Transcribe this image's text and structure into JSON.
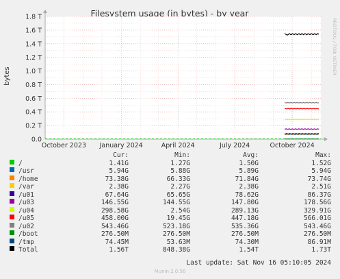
{
  "chart_data": {
    "type": "line",
    "title": "Filesystem usage (in bytes) - by year",
    "ylabel": "bytes",
    "side_label": "RRDTOOL / TOBI OETIKER",
    "ylim": [
      0,
      1.8
    ],
    "yunit": "T",
    "y_ticks": [
      {
        "value": 0.0,
        "label": "0.0"
      },
      {
        "value": 0.2,
        "label": "0.2 T"
      },
      {
        "value": 0.4,
        "label": "0.4 T"
      },
      {
        "value": 0.6,
        "label": "0.6 T"
      },
      {
        "value": 0.8,
        "label": "0.8 T"
      },
      {
        "value": 1.0,
        "label": "1.0 T"
      },
      {
        "value": 1.2,
        "label": "1.2 T"
      },
      {
        "value": 1.4,
        "label": "1.4 T"
      },
      {
        "value": 1.6,
        "label": "1.6 T"
      },
      {
        "value": 1.8,
        "label": "1.8 T"
      }
    ],
    "x_range": [
      "2023-09-01",
      "2024-11-16"
    ],
    "x_ticks": [
      {
        "date": "2023-10-01",
        "label": "October 2023"
      },
      {
        "date": "2024-01-01",
        "label": "January 2024"
      },
      {
        "date": "2024-04-01",
        "label": "April 2024"
      },
      {
        "date": "2024-07-01",
        "label": "July 2024"
      },
      {
        "date": "2024-10-01",
        "label": "October 2024"
      }
    ],
    "data_start": "2024-09-19",
    "series": [
      {
        "name": "/",
        "color": "#00cc00",
        "level": 0.0015
      },
      {
        "name": "/usr",
        "color": "#0066b3",
        "level": 0.006
      },
      {
        "name": "/home",
        "color": "#ff8000",
        "level": 0.072
      },
      {
        "name": "/var",
        "color": "#ffcc00",
        "level": 0.0024
      },
      {
        "name": "/u01",
        "color": "#330099",
        "level": 0.079
      },
      {
        "name": "/u03",
        "color": "#990099",
        "level": 0.148
      },
      {
        "name": "/u04",
        "color": "#ccff00",
        "level": 0.289
      },
      {
        "name": "/u05",
        "color": "#ff0000",
        "level": 0.447
      },
      {
        "name": "/u02",
        "color": "#808080",
        "level": 0.535
      },
      {
        "name": "/boot",
        "color": "#008f00",
        "level": 0.00028
      },
      {
        "name": "/tmp",
        "color": "#00487d",
        "level": 0.074
      },
      {
        "name": "Total",
        "color": "#000000",
        "level": 1.54
      }
    ]
  },
  "legend": {
    "header": {
      "cur": "Cur:",
      "min": "Min:",
      "avg": "Avg:",
      "max": "Max:"
    },
    "rows": [
      {
        "name": "/",
        "cur": "1.41G",
        "min": "1.27G",
        "avg": "1.50G",
        "max": "1.52G"
      },
      {
        "name": "/usr",
        "cur": "5.94G",
        "min": "5.88G",
        "avg": "5.89G",
        "max": "5.94G"
      },
      {
        "name": "/home",
        "cur": "73.38G",
        "min": "66.33G",
        "avg": "71.84G",
        "max": "73.74G"
      },
      {
        "name": "/var",
        "cur": "2.38G",
        "min": "2.27G",
        "avg": "2.38G",
        "max": "2.51G"
      },
      {
        "name": "/u01",
        "cur": "67.64G",
        "min": "65.65G",
        "avg": "78.62G",
        "max": "86.37G"
      },
      {
        "name": "/u03",
        "cur": "146.55G",
        "min": "144.55G",
        "avg": "147.80G",
        "max": "178.56G"
      },
      {
        "name": "/u04",
        "cur": "298.58G",
        "min": "2.54G",
        "avg": "289.13G",
        "max": "329.91G"
      },
      {
        "name": "/u05",
        "cur": "458.00G",
        "min": "19.45G",
        "avg": "447.18G",
        "max": "566.01G"
      },
      {
        "name": "/u02",
        "cur": "543.46G",
        "min": "523.18G",
        "avg": "535.36G",
        "max": "543.46G"
      },
      {
        "name": "/boot",
        "cur": "276.50M",
        "min": "276.50M",
        "avg": "276.50M",
        "max": "276.50M"
      },
      {
        "name": "/tmp",
        "cur": "74.45M",
        "min": "53.63M",
        "avg": "74.30M",
        "max": "86.91M"
      },
      {
        "name": "Total",
        "cur": "1.56T",
        "min": "848.38G",
        "avg": "1.54T",
        "max": "1.73T"
      }
    ]
  },
  "footer": {
    "last_update": "Last update: Sat Nov 16 05:10:05 2024",
    "version": "Munin 2.0.56"
  }
}
